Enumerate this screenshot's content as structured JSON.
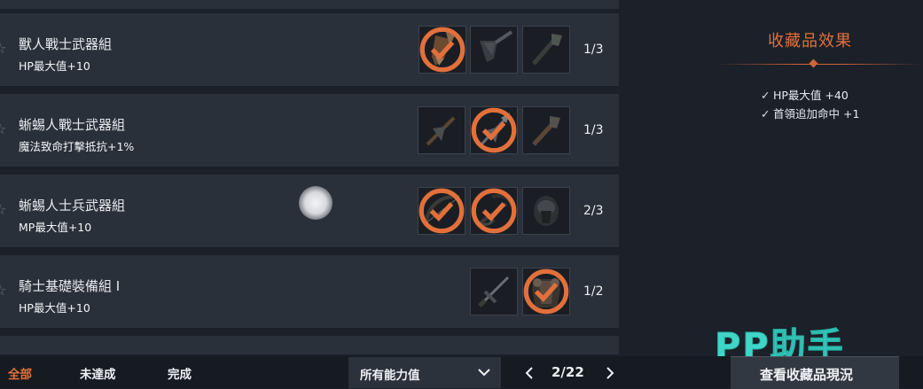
{
  "collection_sets": [
    {
      "title": "獸人戰士武器組",
      "effect": "HP最大值+10",
      "progress": "1/3",
      "slots": [
        {
          "item": "orc-axe-icon",
          "collected": true
        },
        {
          "item": "orc-spear-icon",
          "collected": false
        },
        {
          "item": "orc-club-icon",
          "collected": false
        }
      ]
    },
    {
      "title": "蜥蜴人戰士武器組",
      "effect": "魔法致命打擊抵抗+1%",
      "progress": "1/3",
      "slots": [
        {
          "item": "lizard-axe-icon",
          "collected": false
        },
        {
          "item": "lizard-glaive-icon",
          "collected": true
        },
        {
          "item": "lizard-club-icon",
          "collected": false
        }
      ]
    },
    {
      "title": "蜥蜴人士兵武器組",
      "effect": "MP最大值+10",
      "progress": "2/3",
      "slots": [
        {
          "item": "bow-icon",
          "collected": true
        },
        {
          "item": "crossbow-icon",
          "collected": true
        },
        {
          "item": "helmet-icon",
          "collected": false
        }
      ]
    },
    {
      "title": "騎士基礎裝備組 I",
      "effect": "HP最大值+10",
      "progress": "1/2",
      "slots": [
        {
          "item": "knight-sword-icon",
          "collected": false
        },
        {
          "item": "knight-armor-icon",
          "collected": true
        }
      ]
    }
  ],
  "effects_panel": {
    "title": "收藏品效果",
    "items": [
      "HP最大值 +40",
      "首領追加命中 +1"
    ]
  },
  "bottom_bar": {
    "tabs": [
      "全部",
      "未達成",
      "完成"
    ],
    "active_tab": "全部",
    "filter_label": "所有能力值",
    "pager": "2/22",
    "view_button": "查看收藏品現況"
  },
  "watermark": "PP助手",
  "colors": {
    "accent": "#e2703a",
    "row_bg": "#2a3039",
    "watermark": "#3fd6c8"
  }
}
